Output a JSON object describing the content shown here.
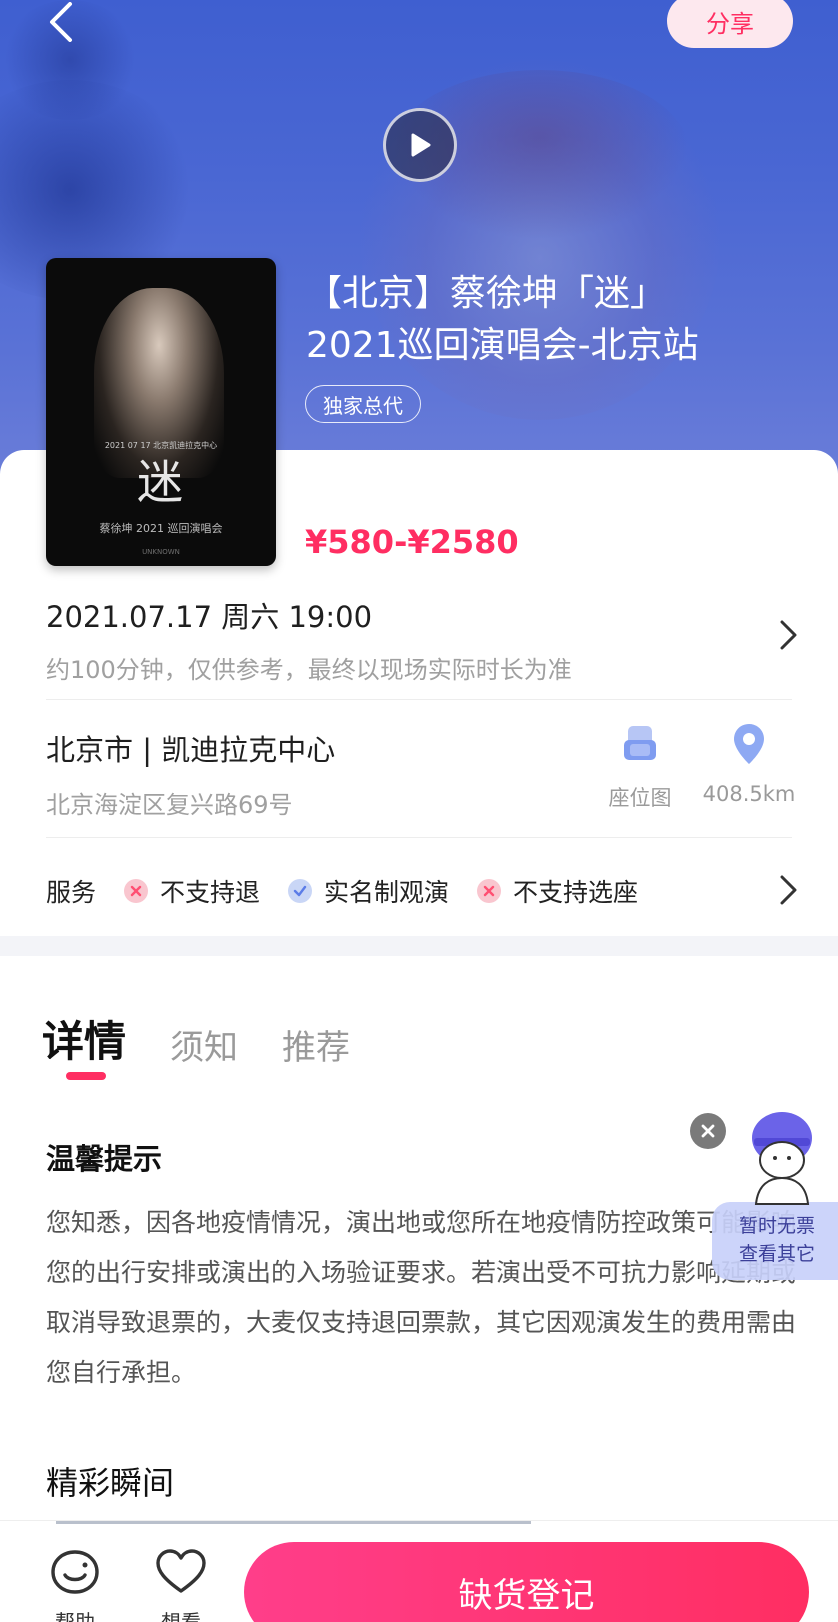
{
  "header": {
    "share_label": "分享"
  },
  "event": {
    "title_line1": "【北京】蔡徐坤「迷」",
    "title_line2": "2021巡回演唱会-北京站",
    "tag": "独家总代",
    "price": "¥580-¥2580",
    "poster": {
      "title": "迷",
      "subtitle_top": "2021 07 17 北京凯迪拉克中心",
      "subtitle_bottom": "蔡徐坤 2021 巡回演唱会",
      "english": "UNKNOWN"
    }
  },
  "schedule": {
    "datetime": "2021.07.17 周六 19:00",
    "duration_note": "约100分钟，仅供参考，最终以现场实际时长为准"
  },
  "venue": {
    "name": "北京市 | 凯迪拉克中心",
    "address": "北京海淀区复兴路69号",
    "seat_map_label": "座位图",
    "distance": "408.5km"
  },
  "services": {
    "label": "服务",
    "items": [
      {
        "text": "不支持退",
        "status": "no"
      },
      {
        "text": "实名制观演",
        "status": "yes"
      },
      {
        "text": "不支持选座",
        "status": "no"
      }
    ]
  },
  "tabs": [
    {
      "label": "详情",
      "active": true
    },
    {
      "label": "须知",
      "active": false
    },
    {
      "label": "推荐",
      "active": false
    }
  ],
  "notice": {
    "title": "温馨提示",
    "body": "您知悉，因各地疫情情况，演出地或您所在地疫情防控政策可能影响您的出行安排或演出的入场验证要求。若演出受不可抗力影响延期或取消导致退票的，大麦仅支持退回票款，其它因观演发生的费用需由您自行承担。"
  },
  "highlights": {
    "title": "精彩瞬间"
  },
  "helper": {
    "line1": "暂时无票",
    "line2": "查看其它"
  },
  "bottom_bar": {
    "help_label": "帮助",
    "want_label": "想看",
    "cta_label": "缺货登记"
  },
  "colors": {
    "accent": "#ff2e62",
    "hero_blue": "#4a67d3"
  }
}
